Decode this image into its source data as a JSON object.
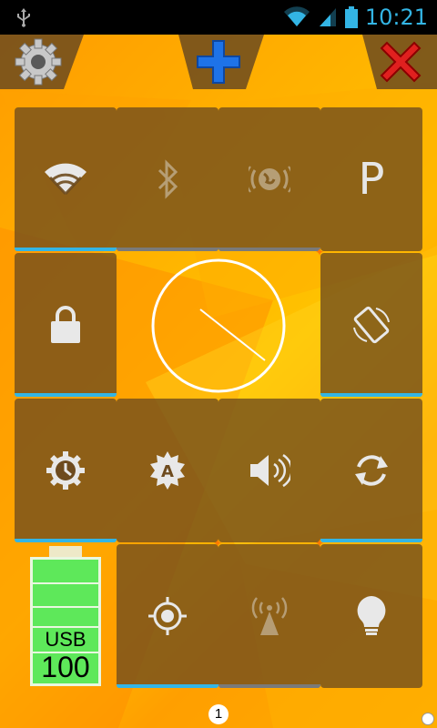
{
  "status_bar": {
    "time": "10:21",
    "icons": [
      "usb-icon",
      "wifi-icon",
      "signal-icon",
      "battery-icon"
    ]
  },
  "toolbar": {
    "left": "settings-gear-icon",
    "middle": "add-plus-icon",
    "right": "close-x-icon"
  },
  "tiles": [
    {
      "name": "wifi",
      "icon": "wifi-icon",
      "enabled": true
    },
    {
      "name": "bluetooth",
      "icon": "bluetooth-icon",
      "enabled": false
    },
    {
      "name": "mobile-data",
      "icon": "globe-icon",
      "enabled": false
    },
    {
      "name": "profile",
      "label": "P",
      "enabled": null
    },
    {
      "name": "screen-lock",
      "icon": "lock-icon",
      "enabled": true
    },
    {
      "name": "auto-rotate",
      "icon": "rotate-icon",
      "enabled": true
    },
    {
      "name": "screen-timeout",
      "icon": "timer-gear-icon",
      "enabled": true
    },
    {
      "name": "auto-brightness",
      "icon": "brightness-auto-icon",
      "enabled": null
    },
    {
      "name": "sound",
      "icon": "speaker-icon",
      "enabled": null
    },
    {
      "name": "sync",
      "icon": "sync-icon",
      "enabled": true
    },
    {
      "name": "gps",
      "icon": "gps-icon",
      "enabled": true
    },
    {
      "name": "hotspot",
      "icon": "hotspot-icon",
      "enabled": false
    },
    {
      "name": "flashlight",
      "icon": "bulb-icon",
      "enabled": null
    }
  ],
  "clock": {
    "hour_hand_angle_deg": 127,
    "minute_hand_angle_deg": 127
  },
  "battery": {
    "source": "USB",
    "level": "100"
  },
  "pager": {
    "page": "1"
  }
}
